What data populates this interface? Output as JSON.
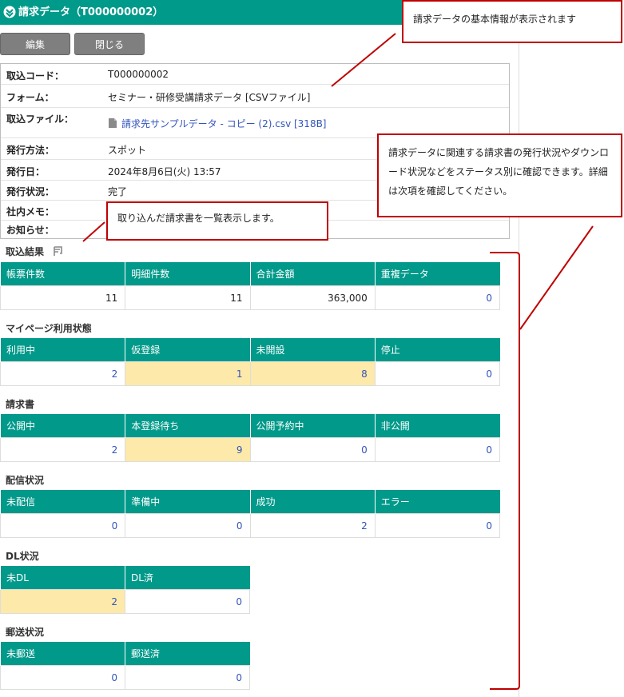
{
  "window": {
    "title": "請求データ（T000000002）"
  },
  "toolbar": {
    "edit_label": "編集",
    "close_label": "閉じる"
  },
  "info": {
    "rows": [
      {
        "label": "取込コード：",
        "value": "T000000002"
      },
      {
        "label": "フォーム：",
        "value": "セミナー・研修受講請求データ [CSVファイル]"
      },
      {
        "label": "取込ファイル：",
        "value": "請求先サンプルデータ - コピー (2).csv [318B]"
      },
      {
        "label": "発行方法：",
        "value": "スポット"
      },
      {
        "label": "発行日：",
        "value": "2024年8月6日(火) 13:57"
      },
      {
        "label": "発行状況：",
        "value": "完了"
      },
      {
        "label": "社内メモ：",
        "value": ""
      },
      {
        "label": "お知らせ：",
        "value": ""
      }
    ]
  },
  "import_result": {
    "title": "取込結果",
    "headers": [
      "帳票件数",
      "明細件数",
      "合計金額",
      "重複データ"
    ],
    "values": [
      "11",
      "11",
      "363,000",
      "0"
    ]
  },
  "mypage": {
    "title": "マイページ利用状態",
    "headers": [
      "利用中",
      "仮登録",
      "未開設",
      "停止"
    ],
    "values": [
      "2",
      "1",
      "8",
      "0"
    ]
  },
  "invoice": {
    "title": "請求書",
    "headers": [
      "公開中",
      "本登録待ち",
      "公開予約中",
      "非公開"
    ],
    "values": [
      "2",
      "9",
      "0",
      "0"
    ]
  },
  "delivery": {
    "title": "配信状況",
    "headers": [
      "未配信",
      "準備中",
      "成功",
      "エラー"
    ],
    "values": [
      "0",
      "0",
      "2",
      "0"
    ]
  },
  "dl": {
    "title": "DL状況",
    "headers": [
      "未DL",
      "DL済"
    ],
    "values": [
      "2",
      "0"
    ]
  },
  "mail": {
    "title": "郵送状況",
    "headers": [
      "未郵送",
      "郵送済"
    ],
    "values": [
      "0",
      "0"
    ]
  },
  "callouts": {
    "basic": "請求データの基本情報が表示されます",
    "list": "取り込んだ請求書を一覧表示します。",
    "status": "請求データに関連する請求書の発行状況やダウンロード状況などをステータス別に確認できます。詳細は次項を確認してください。"
  },
  "colors": {
    "header_teal": "#009a8a",
    "highlight": "#fde9a9",
    "link": "#3355bb",
    "callout_border": "#c00000"
  }
}
